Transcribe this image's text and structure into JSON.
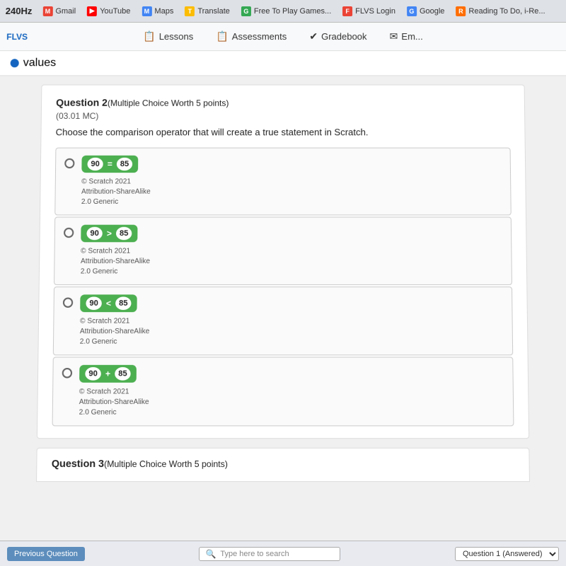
{
  "browser": {
    "time": "240Hz",
    "bookmarks": [
      {
        "label": "Gmail",
        "icon": "M",
        "color": "#ea4335"
      },
      {
        "label": "YouTube",
        "icon": "▶",
        "color": "#ff0000"
      },
      {
        "label": "Maps",
        "icon": "📍",
        "color": "#4285f4"
      },
      {
        "label": "Translate",
        "icon": "T",
        "color": "#fbbc04"
      },
      {
        "label": "Free To Play Games...",
        "icon": "G",
        "color": "#34a853"
      },
      {
        "label": "FLVS Login",
        "icon": "F",
        "color": "#ea4335"
      },
      {
        "label": "Google",
        "icon": "G",
        "color": "#4285f4"
      },
      {
        "label": "Reading To Do, i-Re...",
        "icon": "R",
        "color": "#ff6d00"
      }
    ]
  },
  "nav": {
    "brand": "FLVS",
    "items": [
      {
        "label": "Lessons",
        "icon": "📋"
      },
      {
        "label": "Assessments",
        "icon": "📋"
      },
      {
        "label": "Gradebook",
        "icon": "✔"
      },
      {
        "label": "Em...",
        "icon": "✉"
      }
    ]
  },
  "values_label": "values",
  "question2": {
    "title": "Question 2",
    "title_suffix": "(Multiple Choice Worth 5 points)",
    "subtitle": "(03.01 MC)",
    "text": "Choose the comparison operator that will create a true statement in Scratch.",
    "options": [
      {
        "left_num": "90",
        "operator": "=",
        "right_num": "85",
        "attribution_line1": "© Scratch 2021",
        "attribution_line2": "Attribution-ShareAlike",
        "attribution_line3": "2.0 Generic"
      },
      {
        "left_num": "90",
        "operator": ">",
        "right_num": "85",
        "attribution_line1": "© Scratch 2021",
        "attribution_line2": "Attribution-ShareAlike",
        "attribution_line3": "2.0 Generic"
      },
      {
        "left_num": "90",
        "operator": "<",
        "right_num": "85",
        "attribution_line1": "© Scratch 2021",
        "attribution_line2": "Attribution-ShareAlike",
        "attribution_line3": "2.0 Generic"
      },
      {
        "left_num": "90",
        "operator": "+",
        "right_num": "85",
        "attribution_line1": "© Scratch 2021",
        "attribution_line2": "Attribution-ShareAlike",
        "attribution_line3": "2.0 Generic"
      }
    ]
  },
  "question3": {
    "title": "Question 3",
    "title_suffix": "(Multiple Choice Worth 5 points)"
  },
  "bottom": {
    "prev_button": "Previous Question",
    "search_placeholder": "Type here to search",
    "question_select": "Question 1 (Answered)"
  }
}
